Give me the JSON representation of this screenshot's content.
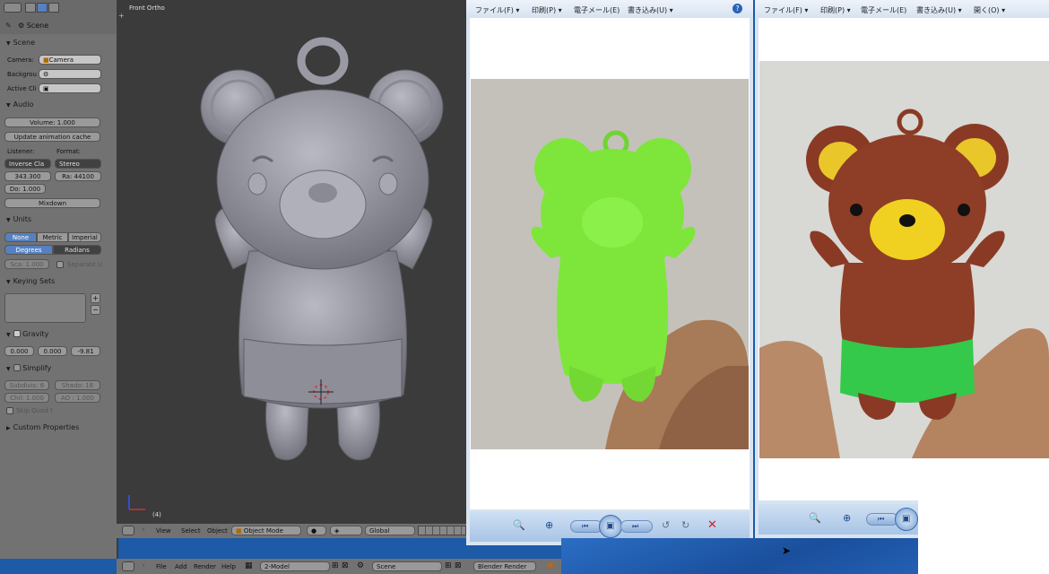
{
  "blender": {
    "properties": {
      "breadcrumb": "Scene",
      "scene_section": {
        "title": "Scene",
        "camera_label": "Camera:",
        "camera_value": "Camera",
        "background_label": "Backgrou",
        "active_clip_label": "Active Cli"
      },
      "audio_section": {
        "title": "Audio",
        "volume": "Volume: 1.000",
        "update_cache": "Update animation cache",
        "listener_label": "Listener:",
        "format_label": "Format:",
        "listener_value": "Inverse Cla",
        "format_value": "Stereo",
        "speed": "343.300",
        "rate": "Ra: 44100",
        "doppler": "Do: 1.000",
        "mixdown": "Mixdown"
      },
      "units_section": {
        "title": "Units",
        "none": "None",
        "metric": "Metric",
        "imperial": "Imperial",
        "degrees": "Degrees",
        "radians": "Radians",
        "scale": "Sca: 1.000",
        "separate": "Separate U"
      },
      "keying_section": {
        "title": "Keying Sets"
      },
      "gravity_section": {
        "title": "Gravity",
        "x": "0.000",
        "y": "0.000",
        "z": "-9.81"
      },
      "simplify_section": {
        "title": "Simplify",
        "subdivision": "Subdivis: 6",
        "shadow": "Shado: 16",
        "child": "Chil: 1.000",
        "ao": "AO : 1.000",
        "skip_quad": "Skip Quad t"
      },
      "custom_section": {
        "title": "Custom Properties"
      }
    },
    "viewport": {
      "label": "Front Ortho",
      "frame_counter": "(4)",
      "menu_view": "View",
      "menu_select": "Select",
      "menu_object": "Object",
      "mode": "Object Mode",
      "orientation": "Global"
    },
    "info": {
      "menu_file": "File",
      "menu_add": "Add",
      "menu_render": "Render",
      "menu_help": "Help",
      "layout": "2-Model",
      "scene": "Scene",
      "engine": "Blender Render"
    }
  },
  "viewer1": {
    "menu": [
      "ファイル(F) ▾",
      "印刷(P) ▾",
      "電子メール(E)",
      "書き込み(U) ▾"
    ]
  },
  "viewer2": {
    "menu": [
      "ファイル(F) ▾",
      "印刷(P) ▾",
      "電子メール(E)",
      "書き込み(U) ▾",
      "開く(O) ▾"
    ]
  },
  "colors": {
    "blender_panel": "#727272",
    "viewport_bg": "#3b3b3b",
    "active_blue": "#5680c2",
    "taskbar_blue": "#1d5aa8",
    "green_print": "#7ee63b",
    "brown_bear": "#8a3a24"
  }
}
